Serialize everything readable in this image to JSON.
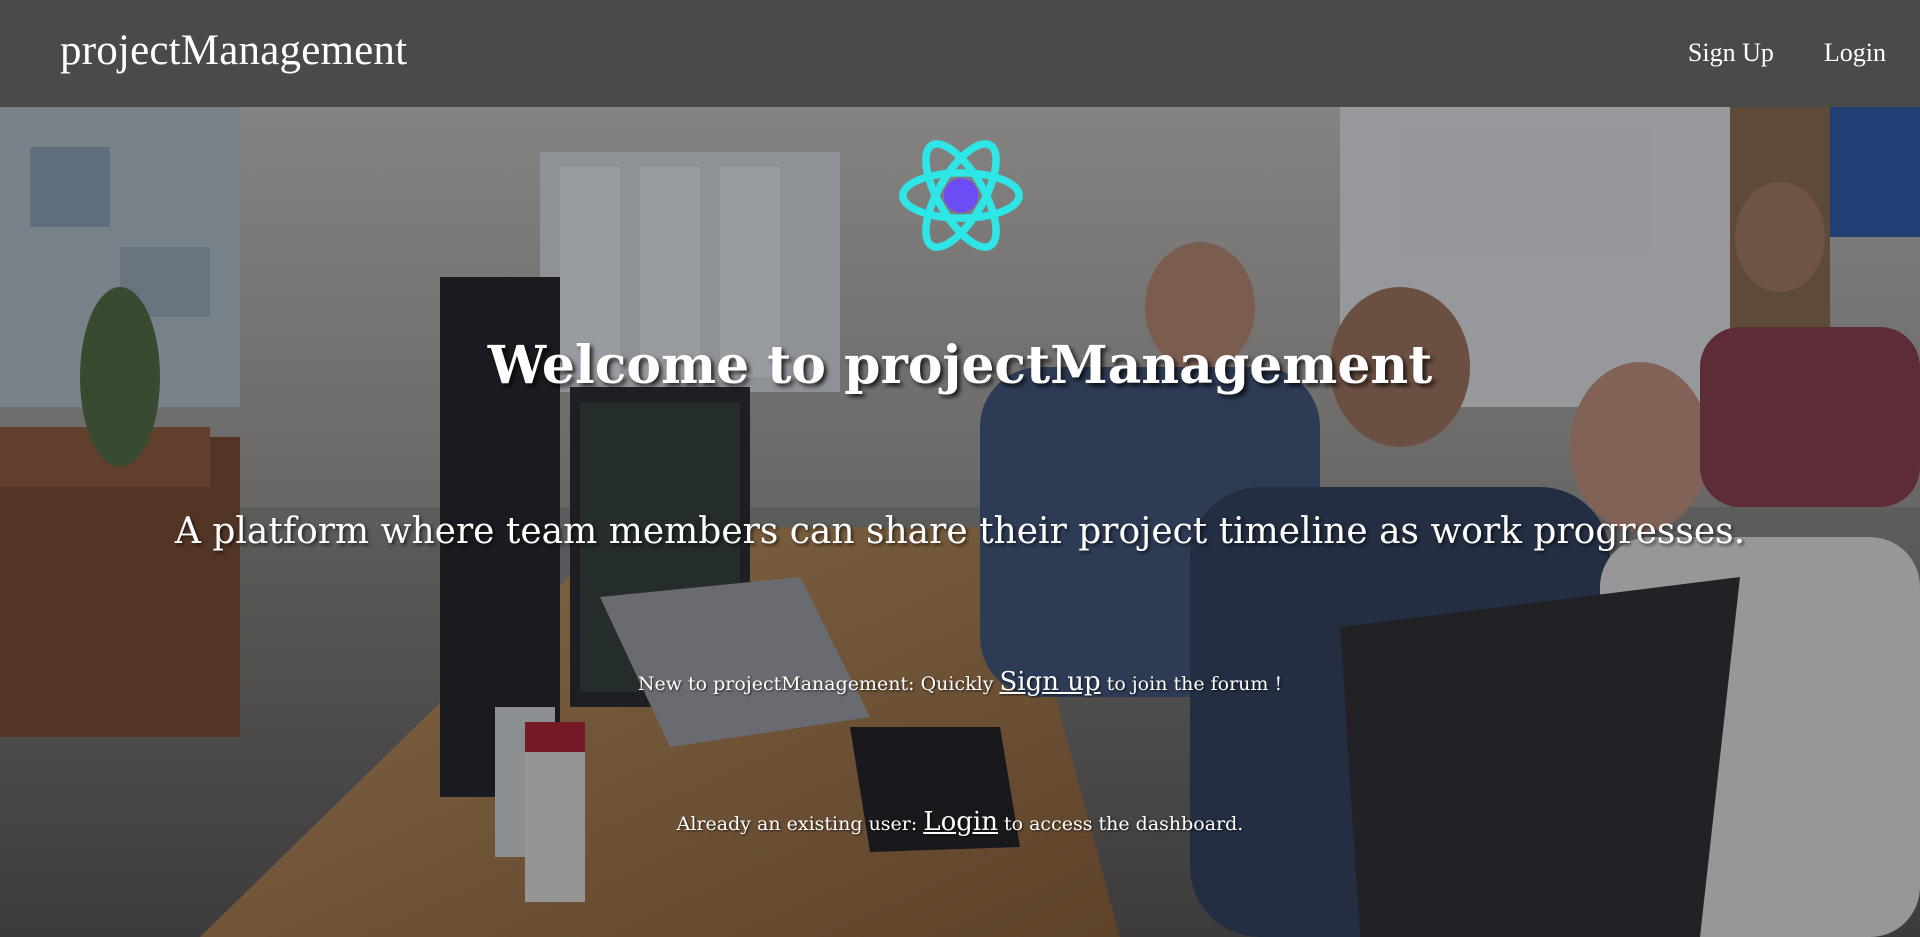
{
  "navbar": {
    "brand": "projectManagement",
    "links": [
      {
        "label": "Sign Up"
      },
      {
        "label": "Login"
      }
    ]
  },
  "hero": {
    "logo_icon": "react-atom-icon",
    "title": "Welcome to projectManagement",
    "tagline": "A platform where team members can share their project timeline as work progresses.",
    "signup_prefix": "New to projectManagement: Quickly ",
    "signup_link": "Sign up",
    "signup_suffix": " to join the forum !",
    "login_prefix": "Already an existing user: ",
    "login_link": "Login",
    "login_suffix": " to access the dashboard."
  },
  "colors": {
    "navbar_bg": "#4a4a4a",
    "text": "#ffffff",
    "logo_ring": "#2ee6e6",
    "logo_core": "#6c4df5"
  }
}
